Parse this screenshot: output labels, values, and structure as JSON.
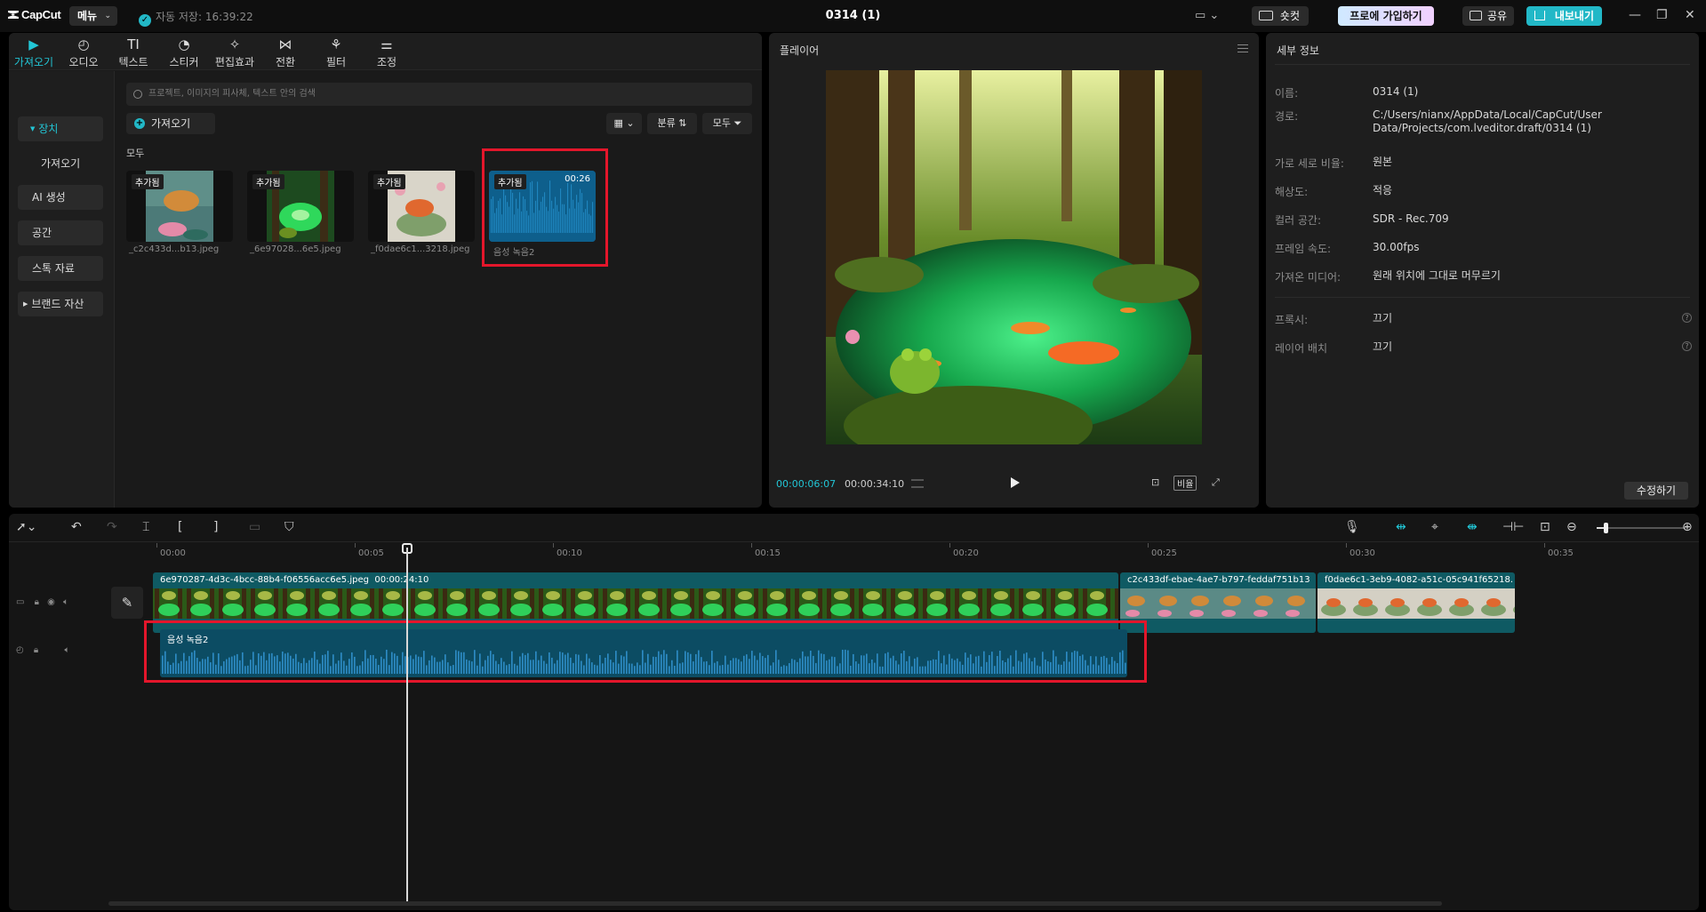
{
  "app": {
    "logo_text": "CapCut",
    "menu_label": "메뉴",
    "autosave_text": "자동 저장: 16:39:22",
    "project_title": "0314 (1)",
    "shortcut_label": "숏컷",
    "pro_label": "프로에 가입하기",
    "share_label": "공유",
    "export_label": "내보내기"
  },
  "media": {
    "top_tabs": [
      {
        "label": "가져오기",
        "glyph": "▶"
      },
      {
        "label": "오디오",
        "glyph": "◴"
      },
      {
        "label": "텍스트",
        "glyph": "TI"
      },
      {
        "label": "스티커",
        "glyph": "◔"
      },
      {
        "label": "편집효과",
        "glyph": "✧"
      },
      {
        "label": "전환",
        "glyph": "⋈"
      },
      {
        "label": "필터",
        "glyph": "⚘"
      },
      {
        "label": "조정",
        "glyph": "⚌"
      }
    ],
    "side_items": [
      "장치",
      "가져오기",
      "AI 생성",
      "공간",
      "스톡 자료",
      "브랜드 자산"
    ],
    "search_placeholder": "프로젝트, 이미지의 피사체, 텍스트 안의 검색",
    "import_label": "가져오기",
    "sort_label": "분류",
    "filter_label": "모두",
    "section_label": "모두",
    "items": [
      {
        "badge": "추가됨",
        "label": "_c2c433d...b13.jpeg"
      },
      {
        "badge": "추가됨",
        "label": "_6e97028...6e5.jpeg"
      },
      {
        "badge": "추가됨",
        "label": "_f0dae6c1...3218.jpeg"
      },
      {
        "badge": "추가됨",
        "duration": "00:26",
        "label": "음성 녹음2"
      }
    ]
  },
  "player": {
    "title": "플레이어",
    "current_time": "00:00:06:07",
    "total_time": "00:00:34:10",
    "ratio_label": "비율"
  },
  "details": {
    "title": "세부 정보",
    "rows": [
      {
        "label": "이름:",
        "value": "0314 (1)"
      },
      {
        "label": "경로:",
        "value": "C:/Users/nianx/AppData/Local/CapCut/User Data/Projects/com.lveditor.draft/0314 (1)"
      },
      {
        "label": "가로 세로 비율:",
        "value": "원본"
      },
      {
        "label": "해상도:",
        "value": "적응"
      },
      {
        "label": "컬러 공간:",
        "value": "SDR - Rec.709"
      },
      {
        "label": "프레임 속도:",
        "value": "30.00fps"
      },
      {
        "label": "가져온 미디어:",
        "value": "원래 위치에 그대로 머무르기"
      },
      {
        "label": "프록시:",
        "value": "끄기"
      },
      {
        "label": "레이어 배치",
        "value": "끄기"
      }
    ],
    "modify_label": "수정하기"
  },
  "timeline": {
    "ruler_labels": [
      "00:00",
      "00:05",
      "00:10",
      "00:15",
      "00:20",
      "00:25",
      "00:30",
      "00:35"
    ],
    "video_clips": [
      {
        "name": "6e970287-4d3c-4bcc-88b4-f06556acc6e5.jpeg",
        "duration": "00:00:24:10"
      },
      {
        "name": "c2c433df-ebae-4ae7-b797-feddaf751b13"
      },
      {
        "name": "f0dae6c1-3eb9-4082-a51c-05c941f65218."
      }
    ],
    "audio_clip": {
      "name": "음성 녹음2"
    }
  },
  "colors": {
    "accent": "#22c6d6",
    "highlight": "#e3162b"
  }
}
